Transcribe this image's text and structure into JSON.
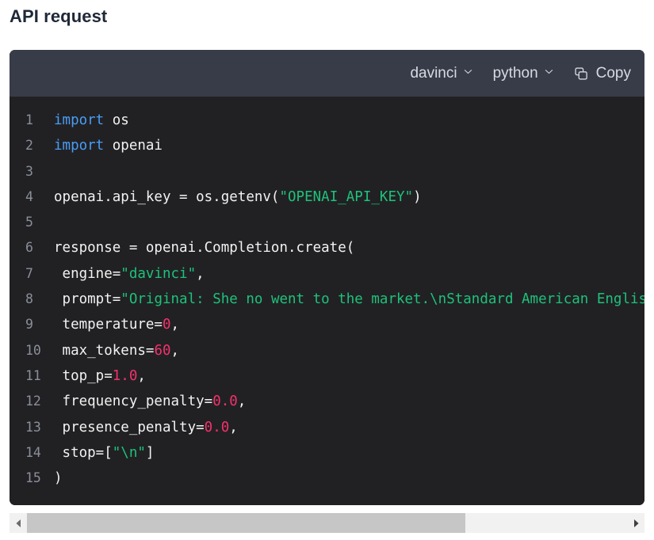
{
  "page": {
    "title": "API request"
  },
  "code_block": {
    "toolbar": {
      "model_label": "davinci",
      "model_chevron_icon": "chevron-down-icon",
      "language_label": "python",
      "language_chevron_icon": "chevron-down-icon",
      "copy_label": "Copy",
      "copy_icon": "copy-icon"
    },
    "language": "python",
    "line_count": 15,
    "lines": [
      {
        "number": "1",
        "tokens": [
          {
            "t": "import",
            "c": "kw"
          },
          {
            "t": " os",
            "c": "pl"
          }
        ]
      },
      {
        "number": "2",
        "tokens": [
          {
            "t": "import",
            "c": "kw"
          },
          {
            "t": " openai",
            "c": "pl"
          }
        ]
      },
      {
        "number": "3",
        "tokens": []
      },
      {
        "number": "4",
        "tokens": [
          {
            "t": "openai.api_key = os.getenv(",
            "c": "pl"
          },
          {
            "t": "\"OPENAI_API_KEY\"",
            "c": "str"
          },
          {
            "t": ")",
            "c": "pl"
          }
        ]
      },
      {
        "number": "5",
        "tokens": []
      },
      {
        "number": "6",
        "tokens": [
          {
            "t": "response = openai.Completion.create(",
            "c": "pl"
          }
        ]
      },
      {
        "number": "7",
        "tokens": [
          {
            "t": "  engine=",
            "c": "pl"
          },
          {
            "t": "\"davinci\"",
            "c": "str"
          },
          {
            "t": ",",
            "c": "pl"
          }
        ]
      },
      {
        "number": "8",
        "tokens": [
          {
            "t": "  prompt=",
            "c": "pl"
          },
          {
            "t": "\"Original: She no went to the market.\\nStandard American English:",
            "c": "str"
          }
        ]
      },
      {
        "number": "9",
        "tokens": [
          {
            "t": "  temperature=",
            "c": "pl"
          },
          {
            "t": "0",
            "c": "num"
          },
          {
            "t": ",",
            "c": "pl"
          }
        ]
      },
      {
        "number": "10",
        "tokens": [
          {
            "t": "  max_tokens=",
            "c": "pl"
          },
          {
            "t": "60",
            "c": "num"
          },
          {
            "t": ",",
            "c": "pl"
          }
        ]
      },
      {
        "number": "11",
        "tokens": [
          {
            "t": "  top_p=",
            "c": "pl"
          },
          {
            "t": "1.0",
            "c": "num"
          },
          {
            "t": ",",
            "c": "pl"
          }
        ]
      },
      {
        "number": "12",
        "tokens": [
          {
            "t": "  frequency_penalty=",
            "c": "pl"
          },
          {
            "t": "0.0",
            "c": "num"
          },
          {
            "t": ",",
            "c": "pl"
          }
        ]
      },
      {
        "number": "13",
        "tokens": [
          {
            "t": "  presence_penalty=",
            "c": "pl"
          },
          {
            "t": "0.0",
            "c": "num"
          },
          {
            "t": ",",
            "c": "pl"
          }
        ]
      },
      {
        "number": "14",
        "tokens": [
          {
            "t": "  stop=[",
            "c": "pl"
          },
          {
            "t": "\"\\n\"",
            "c": "str"
          },
          {
            "t": "]",
            "c": "pl"
          }
        ]
      },
      {
        "number": "15",
        "tokens": [
          {
            "t": ")",
            "c": "pl"
          }
        ]
      }
    ]
  },
  "scrollbar": {
    "left_arrow_icon": "arrow-left-icon",
    "right_arrow_icon": "arrow-right-icon",
    "thumb_fraction_percent": 73,
    "orientation": "horizontal"
  },
  "colors": {
    "page_background": "#ffffff",
    "title_text": "#1f2937",
    "code_background": "#212124",
    "header_background": "#383c49",
    "header_text": "#d7dae1",
    "line_number": "#8a8f98",
    "code_plain": "#f2f2f2",
    "keyword": "#4a9cf6",
    "string": "#1ec27a",
    "number": "#f4316a",
    "scrollbar_track": "#f1f1f1",
    "scrollbar_thumb": "#c6c6c6"
  }
}
